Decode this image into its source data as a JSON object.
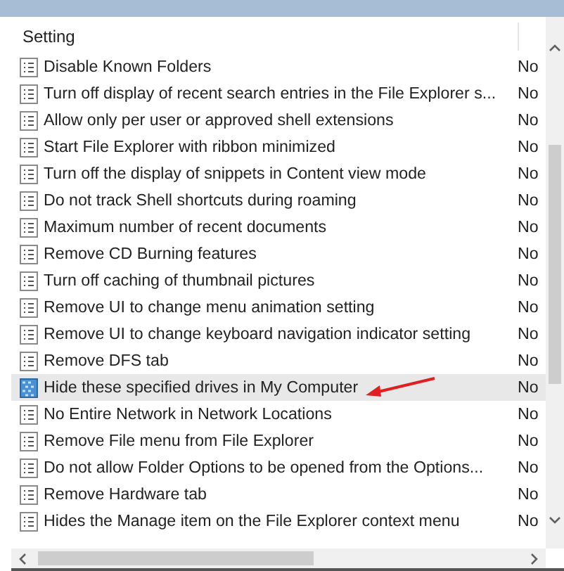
{
  "table": {
    "columns": [
      "Setting"
    ],
    "rows": [
      {
        "name": "Disable Known Folders",
        "state": "No",
        "kind": "policy",
        "selected": false,
        "annotated": false
      },
      {
        "name": "Turn off display of recent search entries in the File Explorer s...",
        "state": "No",
        "kind": "policy",
        "selected": false,
        "annotated": false
      },
      {
        "name": "Allow only per user or approved shell extensions",
        "state": "No",
        "kind": "policy",
        "selected": false,
        "annotated": false
      },
      {
        "name": "Start File Explorer with ribbon minimized",
        "state": "No",
        "kind": "policy",
        "selected": false,
        "annotated": false
      },
      {
        "name": "Turn off the display of snippets in Content view mode",
        "state": "No",
        "kind": "policy",
        "selected": false,
        "annotated": false
      },
      {
        "name": "Do not track Shell shortcuts during roaming",
        "state": "No",
        "kind": "policy",
        "selected": false,
        "annotated": false
      },
      {
        "name": "Maximum number of recent documents",
        "state": "No",
        "kind": "policy",
        "selected": false,
        "annotated": false
      },
      {
        "name": "Remove CD Burning features",
        "state": "No",
        "kind": "policy",
        "selected": false,
        "annotated": false
      },
      {
        "name": "Turn off caching of thumbnail pictures",
        "state": "No",
        "kind": "policy",
        "selected": false,
        "annotated": false
      },
      {
        "name": "Remove UI to change menu animation setting",
        "state": "No",
        "kind": "policy",
        "selected": false,
        "annotated": false
      },
      {
        "name": "Remove UI to change keyboard navigation indicator setting",
        "state": "No",
        "kind": "policy",
        "selected": false,
        "annotated": false
      },
      {
        "name": "Remove DFS tab",
        "state": "No",
        "kind": "policy",
        "selected": false,
        "annotated": false
      },
      {
        "name": "Hide these specified drives in My Computer",
        "state": "No",
        "kind": "drive",
        "selected": true,
        "annotated": true
      },
      {
        "name": "No Entire Network in Network Locations",
        "state": "No",
        "kind": "policy",
        "selected": false,
        "annotated": false
      },
      {
        "name": "Remove File menu from File Explorer",
        "state": "No",
        "kind": "policy",
        "selected": false,
        "annotated": false
      },
      {
        "name": "Do not allow Folder Options to be opened from the Options...",
        "state": "No",
        "kind": "policy",
        "selected": false,
        "annotated": false
      },
      {
        "name": "Remove Hardware tab",
        "state": "No",
        "kind": "policy",
        "selected": false,
        "annotated": false
      },
      {
        "name": "Hides the Manage item on the File Explorer context menu",
        "state": "No",
        "kind": "policy",
        "selected": false,
        "annotated": false
      }
    ]
  }
}
